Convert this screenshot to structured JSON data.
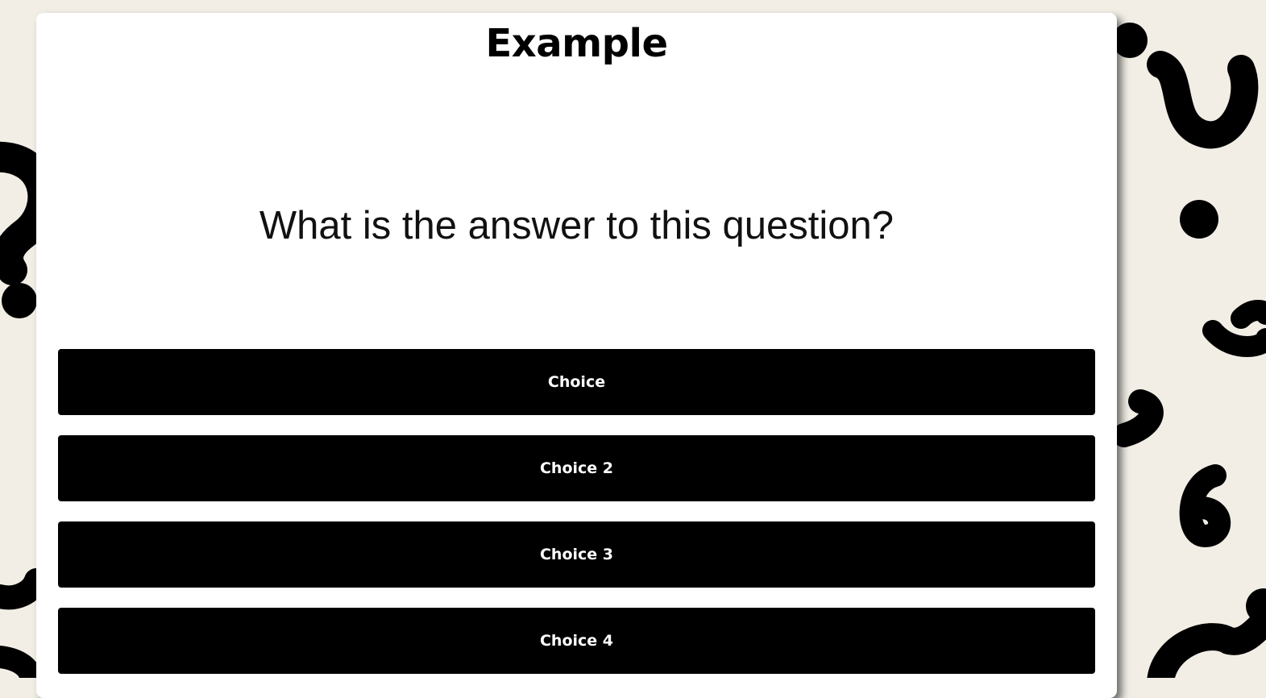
{
  "quiz": {
    "title": "Example",
    "question": "What is the answer to this question?"
  },
  "choices": [
    {
      "label": "Choice"
    },
    {
      "label": "Choice 2"
    },
    {
      "label": "Choice 3"
    },
    {
      "label": "Choice 4"
    }
  ],
  "colors": {
    "background": "#f2eee6",
    "card": "#ffffff",
    "button": "#000000",
    "button_text": "#ffffff",
    "decoration": "#000000"
  },
  "decorations": {
    "icon": "question-mark-doodle-icon"
  }
}
